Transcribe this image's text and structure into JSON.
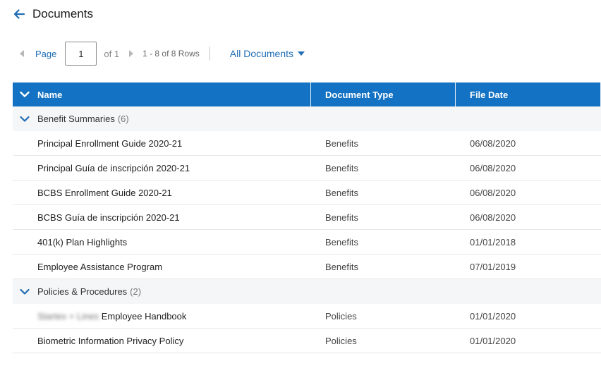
{
  "header": {
    "title": "Documents"
  },
  "toolbar": {
    "page_label": "Page",
    "page_value": "1",
    "of_label": "of 1",
    "rows_label": "1 - 8 of 8 Rows",
    "filter_label": "All Documents"
  },
  "table": {
    "columns": [
      "Name",
      "Document Type",
      "File Date"
    ],
    "groups": [
      {
        "name": "Benefit Summaries",
        "count": "(6)",
        "rows": [
          {
            "name": "Principal Enrollment Guide 2020-21",
            "type": "Benefits",
            "date": "06/08/2020"
          },
          {
            "name": "Principal Guía de inscripción 2020-21",
            "type": "Benefits",
            "date": "06/08/2020"
          },
          {
            "name": "BCBS Enrollment Guide 2020-21",
            "type": "Benefits",
            "date": "06/08/2020"
          },
          {
            "name": "BCBS Guía de inscripción 2020-21",
            "type": "Benefits",
            "date": "06/08/2020"
          },
          {
            "name": "401(k) Plan Highlights",
            "type": "Benefits",
            "date": "01/01/2018"
          },
          {
            "name": "Employee Assistance Program",
            "type": "Benefits",
            "date": "07/01/2019"
          }
        ]
      },
      {
        "name": "Policies & Procedures",
        "count": "(2)",
        "rows": [
          {
            "name_blurred": "Startex + Lines",
            "name": "Employee Handbook",
            "type": "Policies",
            "date": "01/01/2020"
          },
          {
            "name": "Biometric Information Privacy Policy",
            "type": "Policies",
            "date": "01/01/2020"
          }
        ]
      }
    ]
  },
  "colors": {
    "header_bg": "#1372c3",
    "link": "#1f6db4",
    "group_bg": "#f5f6f7"
  }
}
